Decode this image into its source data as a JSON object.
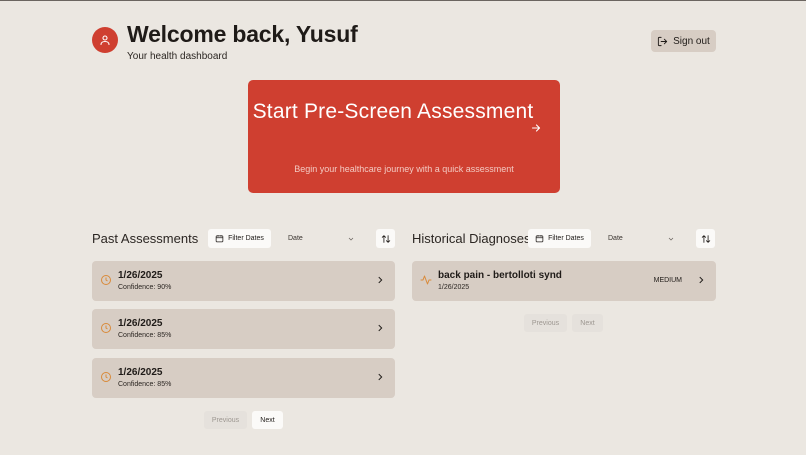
{
  "header": {
    "welcome": "Welcome back, Yusuf",
    "subtitle": "Your health dashboard",
    "signout_label": "Sign out"
  },
  "hero": {
    "title": "Start Pre-Screen Assessment",
    "subtitle": "Begin your healthcare journey with a quick assessment"
  },
  "past": {
    "title": "Past Assessments",
    "filter_label": "Filter Dates",
    "select_value": "Date",
    "items": [
      {
        "date": "1/26/2025",
        "confidence": "Confidence: 90%"
      },
      {
        "date": "1/26/2025",
        "confidence": "Confidence: 85%"
      },
      {
        "date": "1/26/2025",
        "confidence": "Confidence: 85%"
      }
    ],
    "prev_label": "Previous",
    "next_label": "Next"
  },
  "history": {
    "title": "Historical Diagnoses",
    "filter_label": "Filter Dates",
    "select_value": "Date",
    "items": [
      {
        "name": "back pain - bertolloti synd",
        "date": "1/26/2025",
        "severity": "MEDIUM"
      }
    ],
    "prev_label": "Previous",
    "next_label": "Next"
  },
  "colors": {
    "accent": "#cf3f30",
    "background": "#ebe7e1",
    "card": "#d7cdc4",
    "icon": "#d98a3a"
  }
}
